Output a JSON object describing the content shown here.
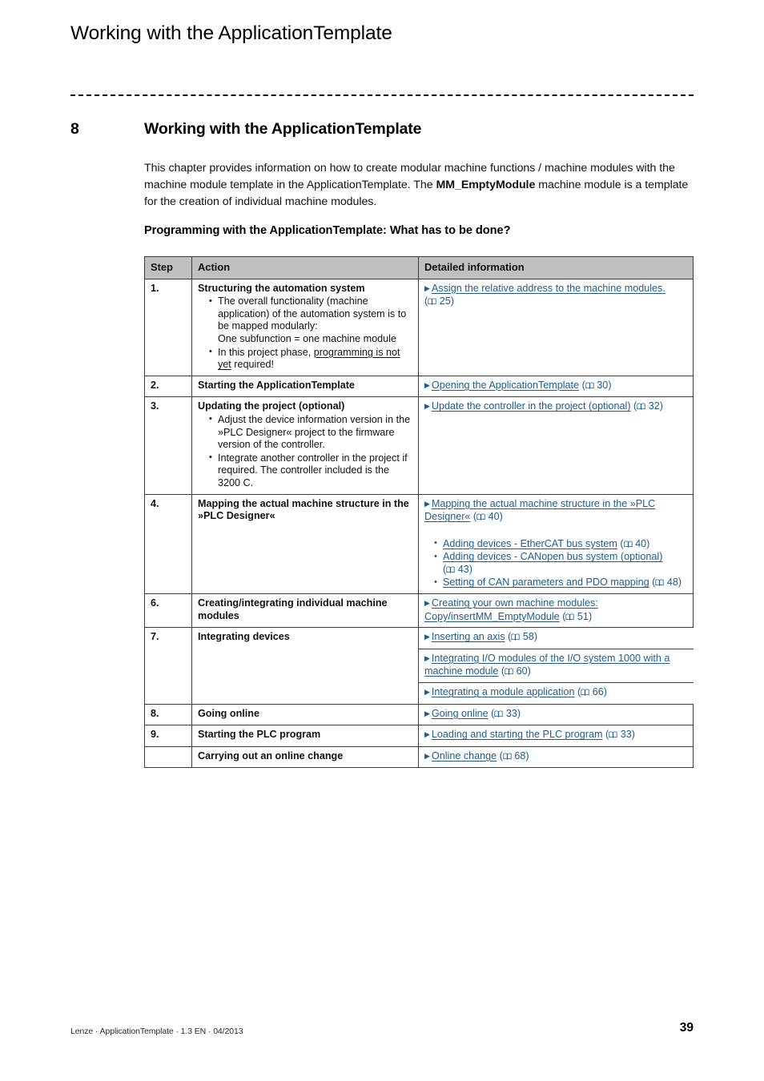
{
  "header": {
    "running_title": "Working with the ApplicationTemplate"
  },
  "chapter": {
    "number": "8",
    "title": "Working with the ApplicationTemplate",
    "intro_part1": "This chapter provides information on how to create modular machine functions / machine modules with the machine module template in the ApplicationTemplate. The ",
    "intro_bold": "MM_EmptyModule",
    "intro_part2": " machine module is a template for the creation of individual machine modules.",
    "sub_heading": "Programming with the ApplicationTemplate: What has to be done?"
  },
  "table": {
    "columns": [
      "Step",
      "Action",
      "Detailed information"
    ],
    "rows": [
      {
        "step": "1.",
        "action_title": "Structuring the automation system",
        "action_bullets": [
          "The overall functionality (machine application) of the automation system is to be mapped modularly:\nOne subfunction = one machine module",
          "In this project phase, programming is not yet required!"
        ],
        "links": [
          {
            "text": "Assign the relative address to the machine modules.",
            "page": "25"
          }
        ]
      },
      {
        "step": "2.",
        "action_title": "Starting the ApplicationTemplate",
        "action_bullets": [],
        "links": [
          {
            "text": "Opening the ApplicationTemplate",
            "page": "30"
          }
        ]
      },
      {
        "step": "3.",
        "action_title": "Updating the project (optional)",
        "action_bullets": [
          "Adjust the device information version in the »PLC Designer« project to the firmware version of the controller.",
          "Integrate another controller in the project if required. The controller included is the 3200 C."
        ],
        "links": [
          {
            "text": "Update the controller in the project (optional)",
            "page": "32"
          }
        ]
      },
      {
        "step": "4.",
        "action_title": "Mapping the actual machine structure in the »PLC Designer«",
        "action_bullets": [],
        "links": [
          {
            "text": "Mapping the actual machine structure in the »PLC Designer«",
            "page": "40"
          }
        ],
        "sub_links": [
          {
            "text": "Adding devices - EtherCAT bus system",
            "page": "40"
          },
          {
            "text": "Adding devices - CANopen bus system (optional)",
            "page": "43"
          },
          {
            "text": "Setting of CAN parameters and PDO mapping",
            "page": "48"
          }
        ]
      },
      {
        "step": "6.",
        "action_title": "Creating/integrating individual machine modules",
        "action_bullets": [],
        "links": [
          {
            "text": "Creating your own machine modules: Copy/insertMM_EmptyModule",
            "page": "51"
          }
        ]
      },
      {
        "step": "7.",
        "action_title": "Integrating devices",
        "action_bullets": [],
        "detail_subrows": [
          {
            "text": "Inserting an axis",
            "page": "58"
          },
          {
            "text": "Integrating I/O modules of the I/O system 1000 with a machine module",
            "page": "60"
          },
          {
            "text": "Integrating a module application",
            "page": "66"
          }
        ]
      },
      {
        "step": "8.",
        "action_title": "Going online",
        "action_bullets": [],
        "links": [
          {
            "text": "Going online",
            "page": "33"
          }
        ]
      },
      {
        "step": "9.",
        "action_title": "Starting the PLC program",
        "action_bullets": [],
        "links": [
          {
            "text": "Loading and starting the PLC program",
            "page": "33"
          }
        ]
      },
      {
        "step": "",
        "action_title": "Carrying out an online change",
        "action_bullets": [],
        "links": [
          {
            "text": "Online change",
            "page": "68"
          }
        ]
      }
    ]
  },
  "footer": {
    "text": "Lenze · ApplicationTemplate · 1.3 EN · 04/2013",
    "page_number": "39"
  },
  "colors": {
    "link": "#1f5c8e",
    "table_header_bg": "#c0c0c0",
    "border": "#3c3c3c"
  }
}
